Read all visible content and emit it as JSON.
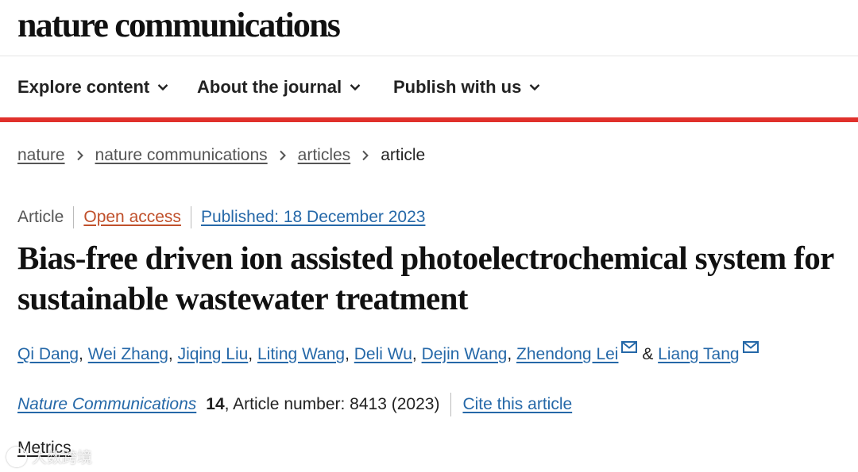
{
  "header": {
    "logo": "nature communications"
  },
  "nav": {
    "items": [
      {
        "label": "Explore content"
      },
      {
        "label": "About the journal"
      },
      {
        "label": "Publish with us"
      }
    ]
  },
  "colors": {
    "accent_red": "#e0302b",
    "link_blue": "#2568a8",
    "open_access_orange": "#c0502b"
  },
  "breadcrumb": {
    "items": [
      {
        "label": "nature"
      },
      {
        "label": "nature communications"
      },
      {
        "label": "articles"
      }
    ],
    "current": "article"
  },
  "article": {
    "type": "Article",
    "access": "Open access",
    "published": "Published: 18 December 2023",
    "title": "Bias-free driven ion assisted photoelectrochemical system for sustainable wastewater treatment",
    "authors": [
      {
        "name": "Qi Dang"
      },
      {
        "name": "Wei Zhang"
      },
      {
        "name": "Jiqing Liu"
      },
      {
        "name": "Liting Wang"
      },
      {
        "name": "Deli Wu"
      },
      {
        "name": "Dejin Wang"
      },
      {
        "name": "Zhendong Lei"
      },
      {
        "name": "Liang Tang"
      }
    ],
    "author_separator": ",",
    "author_conjunction": "&",
    "journal": "Nature Communications",
    "volume": "14",
    "article_number": ", Article number: 8413 (2023)",
    "cite_label": "Cite this article",
    "metrics_label": "Metrics"
  },
  "watermark": {
    "text": "大数跨境"
  }
}
